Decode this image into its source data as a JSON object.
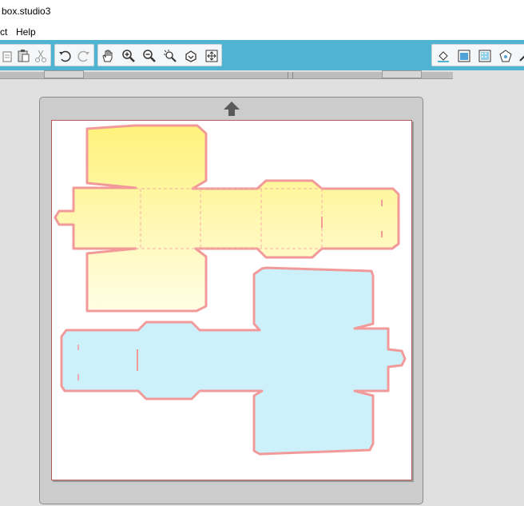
{
  "window": {
    "title": "box.studio3"
  },
  "menu": {
    "items": [
      "ct",
      "Help"
    ]
  },
  "toolbar": {
    "left_tools": [
      "paste-icon",
      "clipboard-icon",
      "scissors-icon",
      "undo-icon",
      "redo-icon",
      "pan-hand-icon",
      "zoom-in-icon",
      "zoom-out-icon",
      "zoom-select-icon",
      "zoom-fit-icon",
      "zoom-to-fit-page-icon"
    ],
    "right_tools": [
      "fill-bucket-icon",
      "line-color-icon",
      "fill-pattern-icon",
      "shape-icon",
      "line-style-icon"
    ]
  },
  "colors": {
    "toolbar_bg": "#4fb3d1",
    "cut_line": "#f29a9a",
    "yellow_fill": "#fff59d",
    "blue_fill": "#ccf1fb",
    "mat_bg": "#cccccc"
  },
  "canvas": {
    "shapes": [
      {
        "name": "yellow-box-template",
        "fill": "yellow"
      },
      {
        "name": "blue-box-template",
        "fill": "blue"
      }
    ]
  }
}
